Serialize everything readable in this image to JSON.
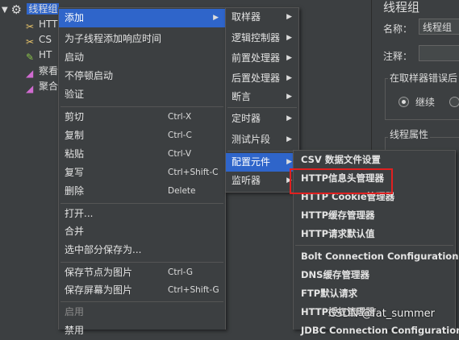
{
  "tree": {
    "root_label": "线程组",
    "children": [
      "HTTP",
      "CS",
      "HT",
      "察看",
      "聚合"
    ]
  },
  "right_pane": {
    "title": "线程组",
    "name_label": "名称：",
    "name_value": "线程组",
    "comment_label": "注释：",
    "error_group_label": "在取样器错误后",
    "continue_label": "继续",
    "thread_props_label": "线程属性"
  },
  "menu_main": [
    {
      "label": "添加",
      "selected": true,
      "arrow": true
    },
    {
      "label": "为子线程添加响应时间"
    },
    {
      "label": "启动"
    },
    {
      "label": "不停顿启动"
    },
    {
      "label": "验证"
    },
    {
      "label": "剪切",
      "accel": "Ctrl-X"
    },
    {
      "label": "复制",
      "accel": "Ctrl-C"
    },
    {
      "label": "粘贴",
      "accel": "Ctrl-V"
    },
    {
      "label": "复写",
      "accel": "Ctrl+Shift-C"
    },
    {
      "label": "删除",
      "accel": "Delete"
    },
    {
      "label": "打开..."
    },
    {
      "label": "合并"
    },
    {
      "label": "选中部分保存为..."
    },
    {
      "label": "保存节点为图片",
      "accel": "Ctrl-G"
    },
    {
      "label": "保存屏幕为图片",
      "accel": "Ctrl+Shift-G"
    },
    {
      "label": "启用",
      "disabled": true
    },
    {
      "label": "禁用"
    }
  ],
  "menu_add": [
    {
      "label": "取样器",
      "arrow": true
    },
    {
      "label": "逻辑控制器",
      "arrow": true
    },
    {
      "label": "前置处理器",
      "arrow": true
    },
    {
      "label": "后置处理器",
      "arrow": true
    },
    {
      "label": "断言",
      "arrow": true
    },
    {
      "label": "定时器",
      "arrow": true
    },
    {
      "label": "测试片段",
      "arrow": true
    },
    {
      "label": "配置元件",
      "arrow": true,
      "selected": true
    },
    {
      "label": "监听器",
      "arrow": true
    }
  ],
  "menu_config": [
    {
      "label": "CSV 数据文件设置"
    },
    {
      "label": "HTTP信息头管理器"
    },
    {
      "label": "HTTP Cookie管理器"
    },
    {
      "label": "HTTP缓存管理器"
    },
    {
      "label": "HTTP请求默认值"
    },
    {
      "label": "Bolt Connection Configuration"
    },
    {
      "label": "DNS缓存管理器"
    },
    {
      "label": "FTP默认请求"
    },
    {
      "label": "HTTP授权管理器"
    },
    {
      "label": "JDBC Connection Configuration"
    }
  ],
  "watermark": "CSDN @fat_summer",
  "colors": {
    "selection": "#2f65ca",
    "highlight_box": "#e02020",
    "background": "#3c3f41"
  }
}
